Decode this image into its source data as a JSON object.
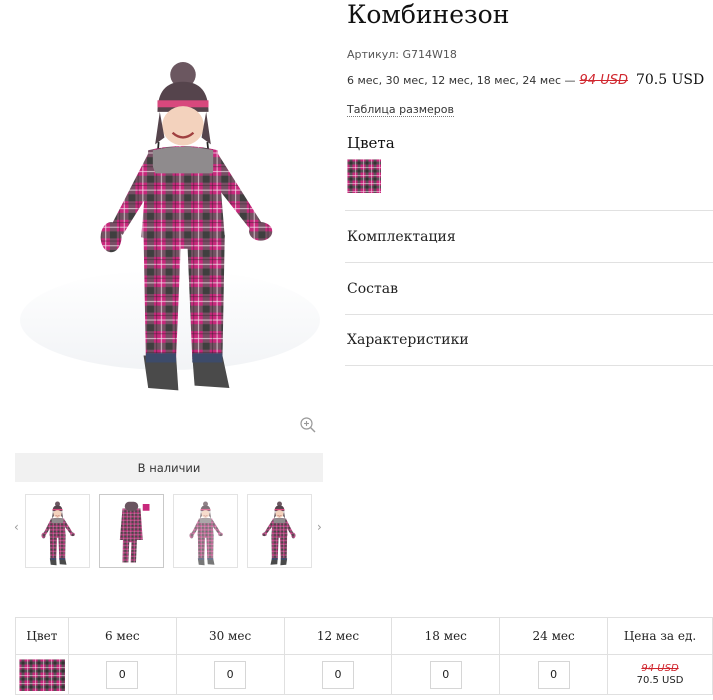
{
  "product": {
    "title": "Комбинезон",
    "sku": "Артикул: G714W18",
    "sizes_text": "6 мес, 30 мес, 12 мес, 18 мес, 24 мес —",
    "old_price": "94 USD",
    "new_price": "70.5 USD",
    "size_table_link": "Таблица размеров",
    "colors_title": "Цвета",
    "stock_status": "В наличии"
  },
  "accordion": [
    {
      "label": "Комплектация"
    },
    {
      "label": "Состав"
    },
    {
      "label": "Характеристики"
    }
  ],
  "gallery": {
    "thumbnail_count": 4,
    "active_index": 1,
    "prev_icon": "‹",
    "next_icon": "›"
  },
  "order_table": {
    "headers": [
      "Цвет",
      "6 мес",
      "30 мес",
      "12 мес",
      "18 мес",
      "24 мес",
      "Цена за ед."
    ],
    "quantities": [
      "0",
      "0",
      "0",
      "0",
      "0"
    ],
    "unit_old_price": "94 USD",
    "unit_new_price": "70.5 USD"
  },
  "colors": {
    "plaid_pink": "#c8287c",
    "plaid_gray": "#5b5b5b",
    "price_red": "#d0262e"
  },
  "icons": {
    "zoom": "zoom-in-icon",
    "prev": "chevron-left-icon",
    "next": "chevron-right-icon"
  }
}
